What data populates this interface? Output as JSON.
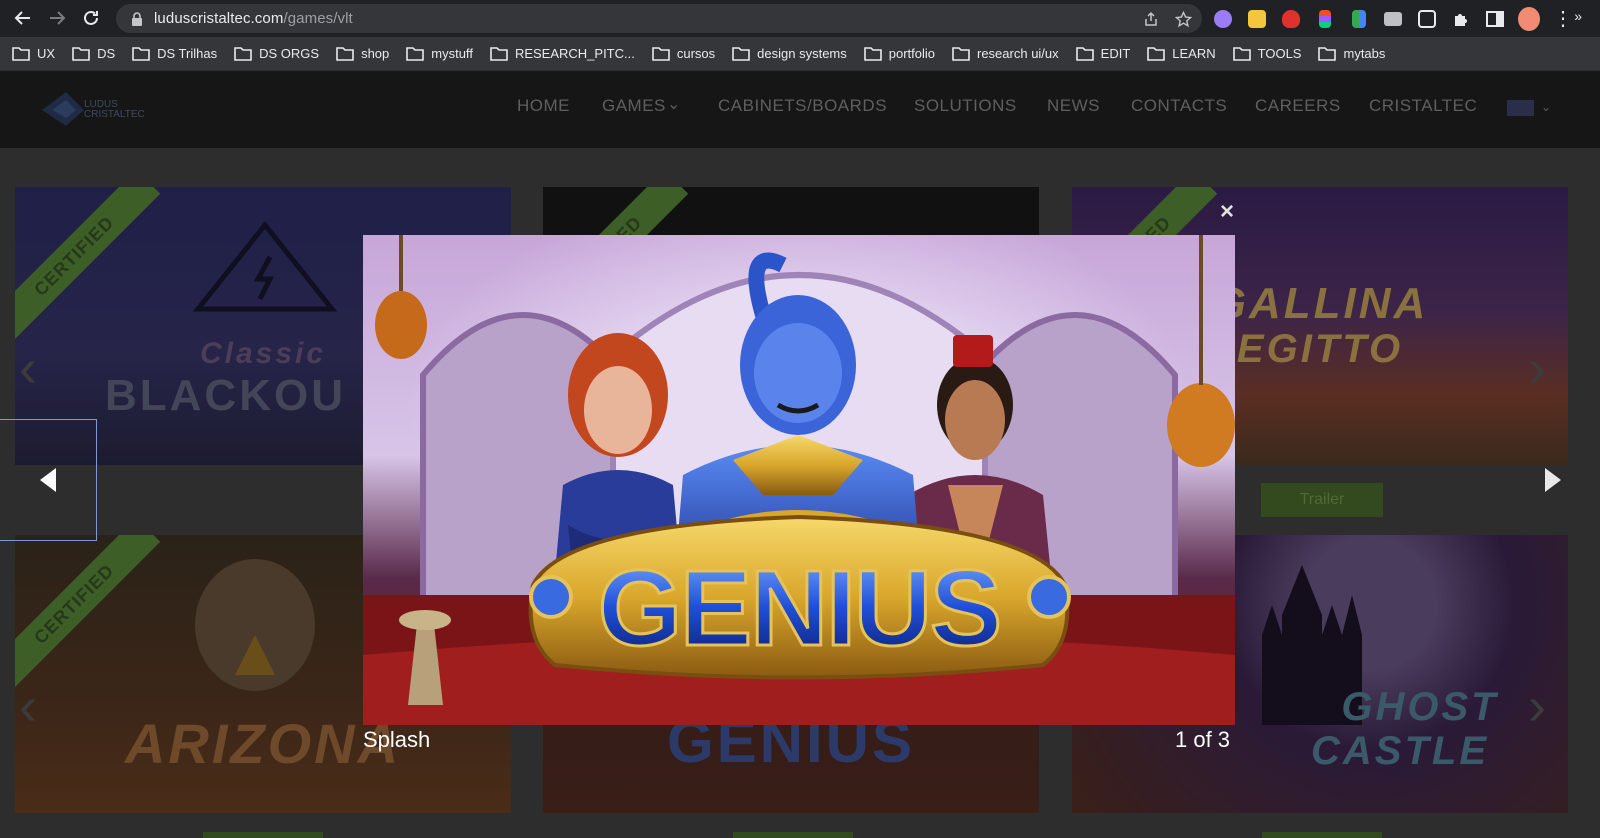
{
  "browser": {
    "url_host": "luduscristaltec.com",
    "url_path": "/games/vlt",
    "bookmarks": [
      "UX",
      "DS",
      "DS Trilhas",
      "DS ORGS",
      "shop",
      "mystuff",
      "RESEARCH_PITC...",
      "cursos",
      "design systems",
      "portfolio",
      "research ui/ux",
      "EDIT",
      "LEARN",
      "TOOLS",
      "mytabs"
    ],
    "bookmarks_overflow": "»"
  },
  "site": {
    "logo_text_line1": "LUDUS",
    "logo_text_line2": "CRISTALTEC",
    "nav": [
      "HOME",
      "GAMES",
      "CABINETS/BOARDS",
      "SOLUTIONS",
      "NEWS",
      "CONTACTS",
      "CAREERS",
      "CRISTALTEC"
    ],
    "games_chevron": "⌄"
  },
  "tiles": [
    {
      "ribbon": "CERTIFIED",
      "title_line1": "Classic",
      "title_line2": "BLACKOU",
      "accent": "#3a3a7a"
    },
    {
      "ribbon": "CERTIFIED",
      "title_line1": "",
      "title_line2": "",
      "accent": "#141414"
    },
    {
      "ribbon": "CERTIFIED",
      "title_line1": "GALLINA",
      "title_line2": "EGITTO",
      "accent": "#4a2e5c"
    },
    {
      "ribbon": "CERTIFIED",
      "title_line1": "ARIZONA",
      "title_line2": "",
      "accent": "#3a2418"
    },
    {
      "ribbon": "",
      "title_line1": "GENIUS",
      "title_line2": "",
      "accent": "#2b1414"
    },
    {
      "ribbon": "",
      "title_line1": "GHOST",
      "title_line2": "CASTLE",
      "accent": "#2a1a38"
    }
  ],
  "trailer_label": "Trailer",
  "lightbox": {
    "logo_text": "GENIUS",
    "caption": "Splash",
    "counter": "1 of 3",
    "close_symbol": "×"
  },
  "colors": {
    "chrome_bg": "#202124",
    "omnibox_bg": "#35363a",
    "genie_blue": "#2b54c8",
    "gold": "#e1b53a"
  }
}
